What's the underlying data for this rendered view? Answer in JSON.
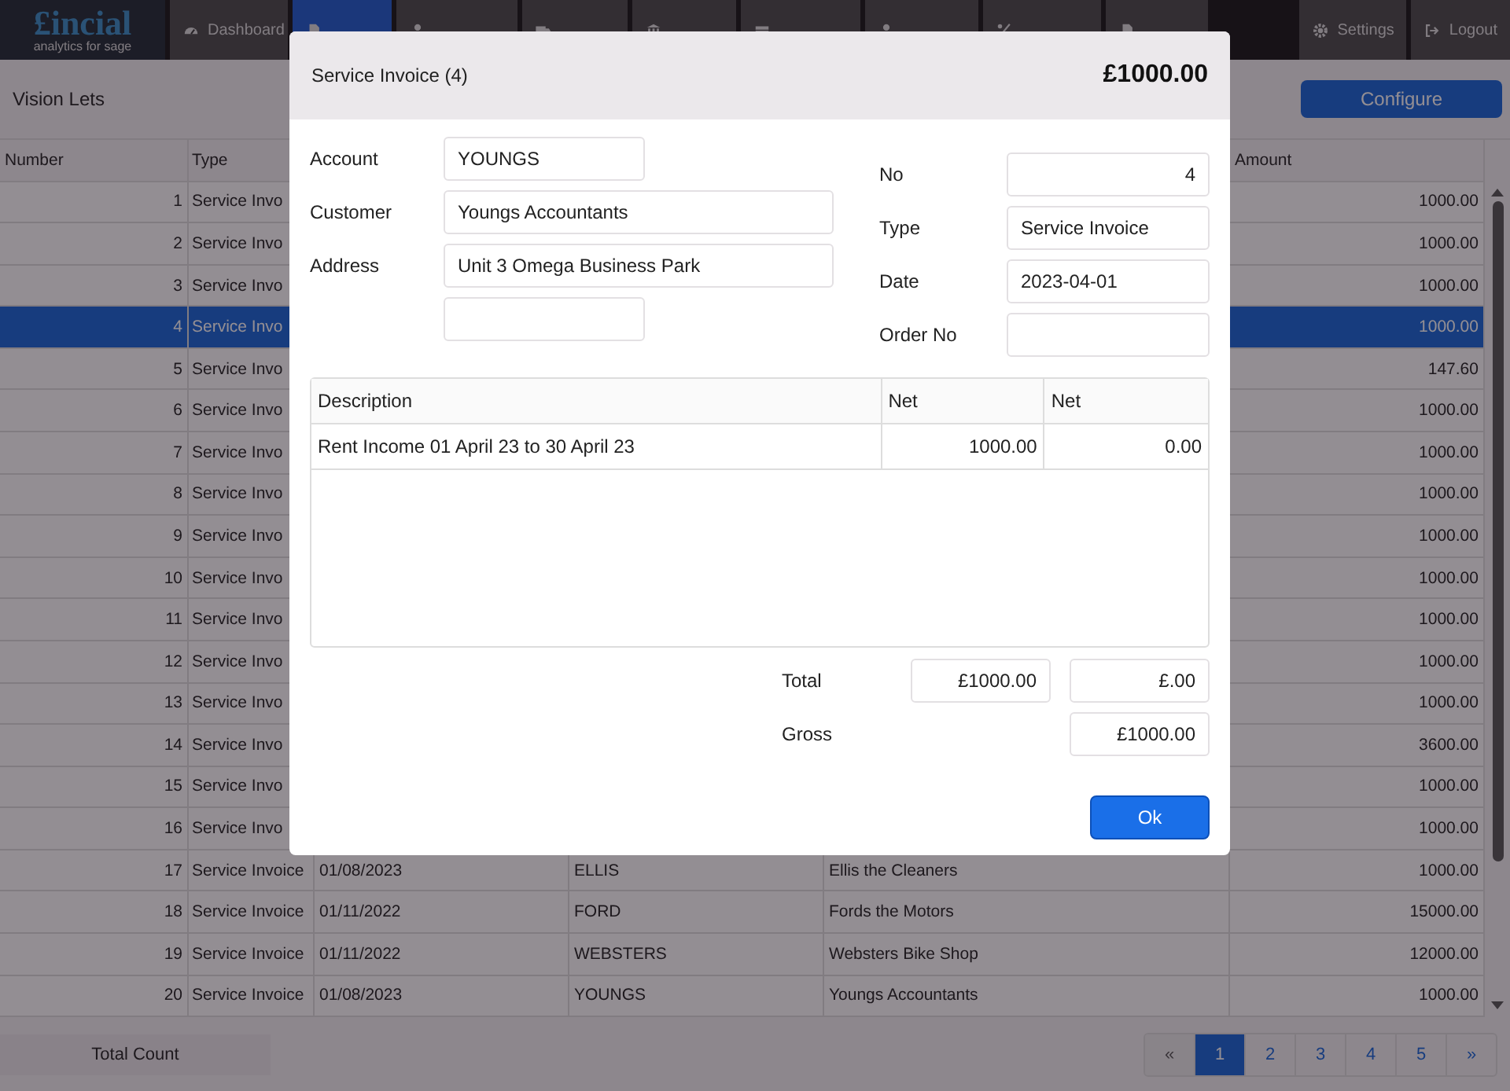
{
  "nav": {
    "logo": {
      "name": "£incial",
      "tagline": "analytics for sage"
    },
    "items": [
      {
        "label": "Dashboard",
        "selected": false
      },
      {
        "selected": true
      },
      {
        "selected": false
      },
      {
        "selected": false
      },
      {
        "selected": false
      },
      {
        "selected": false
      },
      {
        "selected": false
      },
      {
        "selected": false
      },
      {
        "selected": false
      }
    ],
    "right_items": [
      {
        "label": "Settings"
      },
      {
        "label": "Logout"
      }
    ]
  },
  "toolbar": {
    "company": "Vision Lets",
    "button": "Configure"
  },
  "table": {
    "columns": [
      "Number",
      "Type",
      "Amount"
    ],
    "rows": [
      {
        "number": "1",
        "type": "Service Invo",
        "amount": "1000.00",
        "selected": false
      },
      {
        "number": "2",
        "type": "Service Invo",
        "amount": "1000.00",
        "selected": false
      },
      {
        "number": "3",
        "type": "Service Invo",
        "amount": "1000.00",
        "selected": false
      },
      {
        "number": "4",
        "type": "Service Invo",
        "amount": "1000.00",
        "selected": true
      },
      {
        "number": "5",
        "type": "Service Invo",
        "amount": "147.60",
        "selected": false
      },
      {
        "number": "6",
        "type": "Service Invo",
        "amount": "1000.00",
        "selected": false
      },
      {
        "number": "7",
        "type": "Service Invo",
        "amount": "1000.00",
        "selected": false
      },
      {
        "number": "8",
        "type": "Service Invo",
        "amount": "1000.00",
        "selected": false
      },
      {
        "number": "9",
        "type": "Service Invo",
        "amount": "1000.00",
        "selected": false
      },
      {
        "number": "10",
        "type": "Service Invo",
        "amount": "1000.00",
        "selected": false
      },
      {
        "number": "11",
        "type": "Service Invo",
        "amount": "1000.00",
        "selected": false
      },
      {
        "number": "12",
        "type": "Service Invo",
        "amount": "1000.00",
        "selected": false
      },
      {
        "number": "13",
        "type": "Service Invo",
        "amount": "1000.00",
        "selected": false
      },
      {
        "number": "14",
        "type": "Service Invo",
        "amount": "3600.00",
        "selected": false
      },
      {
        "number": "15",
        "type": "Service Invo",
        "amount": "1000.00",
        "selected": false
      },
      {
        "number": "16",
        "type": "Service Invo",
        "amount": "1000.00",
        "selected": false
      },
      {
        "number": "17",
        "type": "Service Invoice",
        "date": "01/08/2023",
        "account": "ELLIS",
        "name": "Ellis the Cleaners",
        "amount": "1000.00",
        "selected": false
      },
      {
        "number": "18",
        "type": "Service Invoice",
        "date": "01/11/2022",
        "account": "FORD",
        "name": "Fords the Motors",
        "amount": "15000.00",
        "selected": false
      },
      {
        "number": "19",
        "type": "Service Invoice",
        "date": "01/11/2022",
        "account": "WEBSTERS",
        "name": "Websters Bike Shop",
        "amount": "12000.00",
        "selected": false
      },
      {
        "number": "20",
        "type": "Service Invoice",
        "date": "01/08/2023",
        "account": "YOUNGS",
        "name": "Youngs Accountants",
        "amount": "1000.00",
        "selected": false
      }
    ]
  },
  "footer": {
    "total_label": "Total Count",
    "pagination": [
      {
        "label": "«",
        "selected": false
      },
      {
        "label": "1",
        "selected": true
      },
      {
        "label": "2",
        "selected": false
      },
      {
        "label": "3",
        "selected": false
      },
      {
        "label": "4",
        "selected": false
      },
      {
        "label": "5",
        "selected": false
      },
      {
        "label": "»",
        "selected": false
      }
    ]
  },
  "dialog": {
    "title": "Service Invoice (4)",
    "amount": "£1000.00",
    "left_fields": [
      {
        "kind": "labeled",
        "label": "Account",
        "value": "YOUNGS"
      },
      {
        "kind": "labeled",
        "label": "Customer",
        "value": "Youngs Accountants"
      },
      {
        "kind": "labeled",
        "label": "Address",
        "value": "Unit 3 Omega Business Park"
      },
      {
        "kind": "blank"
      }
    ],
    "right_fields": [
      {
        "label": "No",
        "value": "4"
      },
      {
        "label": "Type",
        "value": "Service Invoice"
      },
      {
        "label": "Date",
        "value": "2023-04-01"
      },
      {
        "label": "Order No"
      }
    ],
    "lines": {
      "columns": [
        "Description",
        "Net",
        "Net"
      ],
      "rows": [
        [
          "Rent Income 01 April 23 to 30 April 23",
          "1000.00",
          "0.00"
        ]
      ]
    },
    "total_label": "Total",
    "total_values": [
      "£1000.00",
      "£.00"
    ],
    "gross_label": "Gross",
    "gross_value": "£1000.00",
    "ok_button": "Ok"
  }
}
